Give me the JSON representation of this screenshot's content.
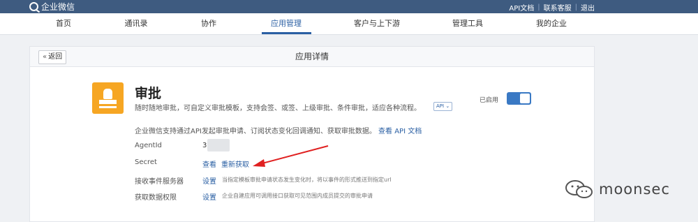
{
  "brand": {
    "name": "企业微信"
  },
  "top_links": [
    "API文档",
    "联系客服",
    "退出"
  ],
  "nav": [
    {
      "label": "首页"
    },
    {
      "label": "通讯录"
    },
    {
      "label": "协作"
    },
    {
      "label": "应用管理",
      "active": true
    },
    {
      "label": "客户与上下游"
    },
    {
      "label": "管理工具"
    },
    {
      "label": "我的企业"
    }
  ],
  "card": {
    "back_label": "返回",
    "title": "应用详情"
  },
  "app": {
    "name": "审批",
    "description": "随时随地审批，可自定义审批模板，支持会签、或签、上级审批、条件审批，适应各种流程。",
    "api_tag": "API",
    "status_label": "已启用",
    "enabled": true,
    "intro": "企业微信支持通过API发起审批申请、订阅状态变化回调通知、获取审批数据。",
    "intro_link": "查看 API 文档"
  },
  "details": {
    "agentid_label": "AgentId",
    "agentid_value": "3",
    "secret_label": "Secret",
    "secret_view": "查看",
    "secret_refresh": "重新获取",
    "event_label": "接收事件服务器",
    "event_action": "设置",
    "event_hint": "当指定模板审批申请状态发生变化时，将以事件的形式推送到指定url",
    "permission_label": "获取数据权限",
    "permission_action": "设置",
    "permission_hint": "企业自建应用可调用接口获取可见范围内成员提交的审批申请"
  },
  "watermark": {
    "text": "moonsec"
  },
  "colors": {
    "topbar": "#3e5b80",
    "accent": "#2a5fa3",
    "app_icon": "#f6a623",
    "toggle_on": "#3a79c4",
    "arrow": "#e02020"
  }
}
